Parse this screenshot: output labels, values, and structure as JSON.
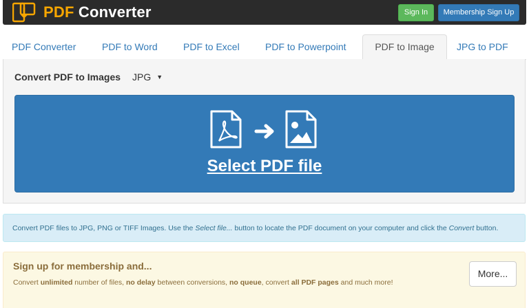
{
  "header": {
    "logo_icon": "document-transfer-icon",
    "brand_part1": "PDF",
    "brand_part2": " Converter",
    "sign_in_label": "Sign In",
    "membership_label": "Membership Sign Up"
  },
  "tabs": [
    {
      "label": "PDF Converter",
      "active": false
    },
    {
      "label": "PDF to Word",
      "active": false
    },
    {
      "label": "PDF to Excel",
      "active": false
    },
    {
      "label": "PDF to Powerpoint",
      "active": false
    },
    {
      "label": "PDF to Image",
      "active": true
    },
    {
      "label": "JPG to PDF",
      "active": false
    }
  ],
  "converter": {
    "title": "Convert PDF to Images",
    "format_selected": "JPG",
    "icons": [
      "pdf-file-icon",
      "arrow-right-icon",
      "image-file-icon"
    ],
    "select_label": "Select PDF file"
  },
  "info": {
    "text_1": "Convert PDF files to JPG, PNG or TIFF Images. Use the ",
    "text_2": "Select file...",
    "text_3": " button to locate the PDF document on your computer and click the ",
    "text_4": "Convert",
    "text_5": " button."
  },
  "membership": {
    "title": "Sign up for membership and...",
    "t1": "Convert ",
    "t2": "unlimited",
    "t3": " number of files, ",
    "t4": "no delay",
    "t5": " between conversions, ",
    "t6": "no queue",
    "t7": ", convert ",
    "t8": "all PDF pages",
    "t9": " and much more!",
    "more_label": "More..."
  },
  "colors": {
    "topbar": "#2b2b2b",
    "brand_accent": "#f7a600",
    "primary": "#337ab7",
    "success": "#5cb85c",
    "info_bg": "#d9edf7",
    "warning_bg": "#fcf8e3"
  }
}
